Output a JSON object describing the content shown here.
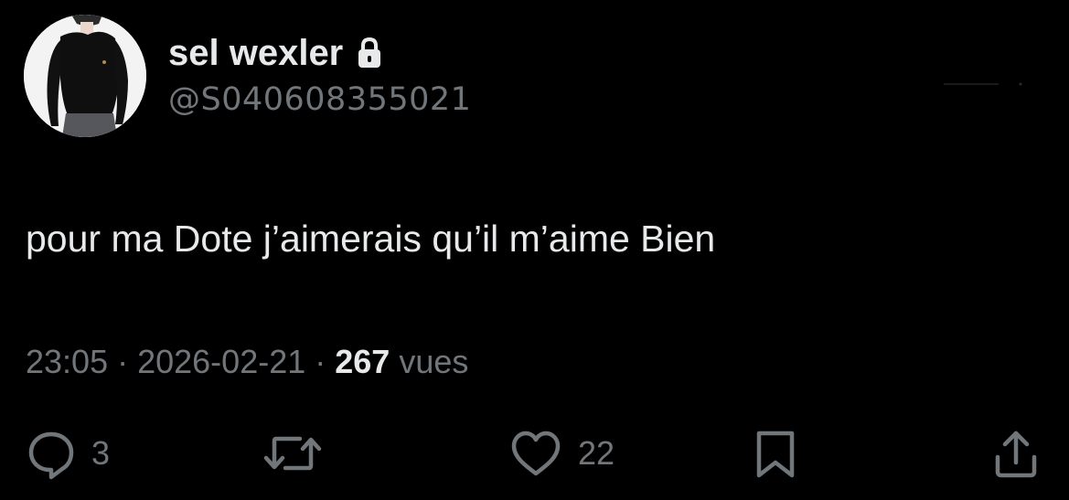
{
  "author": {
    "display_name": "sel wexler",
    "handle": "@S040608355021",
    "protected_icon": "lock-icon",
    "avatar_icon": "profile-photo"
  },
  "tweet": {
    "text": "pour ma Dote j’aimerais qu’il m’aime Bien"
  },
  "meta": {
    "time": "23:05",
    "separator": "·",
    "date": "2026-02-21",
    "views_count": "267",
    "views_label": "vues"
  },
  "actions": {
    "reply": {
      "icon": "reply-bubble-icon",
      "count": "3"
    },
    "retweet": {
      "icon": "retweet-icon",
      "count": ""
    },
    "like": {
      "icon": "heart-icon",
      "count": "22"
    },
    "bookmark": {
      "icon": "bookmark-icon"
    },
    "share": {
      "icon": "share-icon"
    }
  },
  "colors": {
    "background": "#000000",
    "primary_text": "#e7e9ea",
    "secondary_text": "#71767b"
  }
}
